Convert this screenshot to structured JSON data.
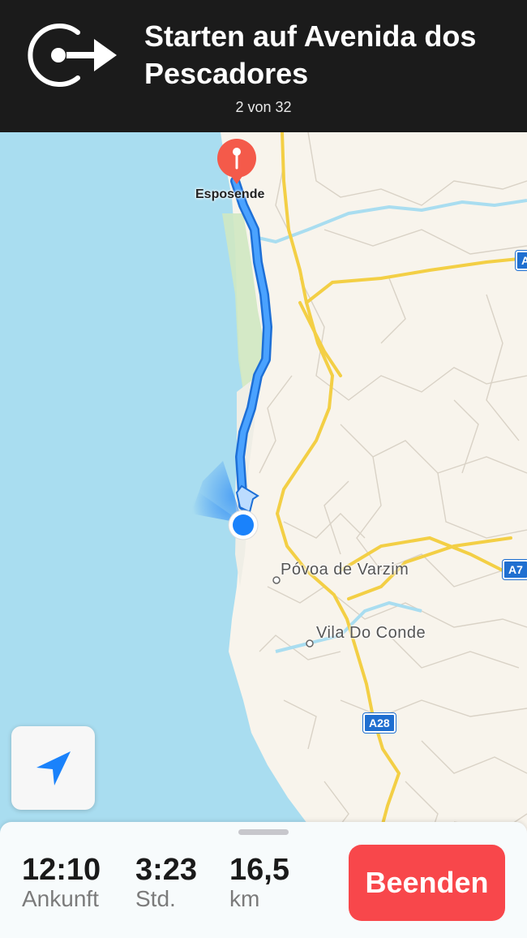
{
  "header": {
    "instruction": "Starten auf Avenida dos Pescadores",
    "step_counter": "2 von 32",
    "maneuver_icon": "start-arrow-icon"
  },
  "map": {
    "labels": {
      "destination": "Esposende",
      "city_1": "Póvoa de Varzim",
      "city_2": "Vila Do Conde"
    },
    "shields": {
      "a7_top": "A",
      "a7": "A7",
      "a28": "A28"
    },
    "colors": {
      "sea": "#a9ddf0",
      "land": "#f8f4ec",
      "route": "#2f8cf5",
      "highway": "#f3cf45",
      "user_location": "#1a82fb",
      "destination_pin": "#f45a4a"
    },
    "icons": [
      "destination-pin-icon",
      "user-location-icon",
      "heading-cone-icon"
    ]
  },
  "controls": {
    "locate_icon": "location-arrow-icon"
  },
  "trip": {
    "arrival_value": "12:10",
    "arrival_label": "Ankunft",
    "duration_value": "3:23",
    "duration_label": "Std.",
    "distance_value": "16,5",
    "distance_label": "km",
    "end_button": "Beenden"
  }
}
